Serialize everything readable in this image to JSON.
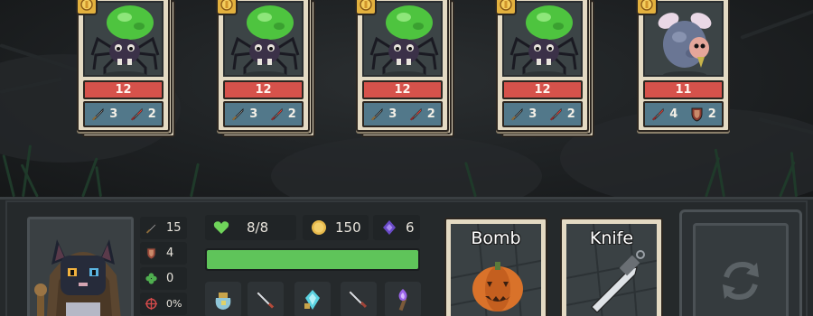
{
  "enemies": [
    {
      "type": "spider",
      "hp": "12",
      "stats": [
        {
          "icon": "sword-icon",
          "value": "3"
        },
        {
          "icon": "red-sword-icon",
          "value": "2"
        }
      ],
      "stacked": true
    },
    {
      "type": "spider",
      "hp": "12",
      "stats": [
        {
          "icon": "sword-icon",
          "value": "3"
        },
        {
          "icon": "red-sword-icon",
          "value": "2"
        }
      ],
      "stacked": true
    },
    {
      "type": "spider",
      "hp": "12",
      "stats": [
        {
          "icon": "sword-icon",
          "value": "3"
        },
        {
          "icon": "red-sword-icon",
          "value": "2"
        }
      ],
      "stacked": true
    },
    {
      "type": "spider",
      "hp": "12",
      "stats": [
        {
          "icon": "sword-icon",
          "value": "3"
        },
        {
          "icon": "red-sword-icon",
          "value": "2"
        }
      ],
      "stacked": true
    },
    {
      "type": "moth",
      "hp": "11",
      "stats": [
        {
          "icon": "red-sword-icon",
          "value": "4"
        },
        {
          "icon": "shield-icon",
          "value": "2"
        }
      ],
      "stacked": false
    }
  ],
  "hero": {
    "stats": {
      "attack": "15",
      "armor": "4",
      "luck": "0",
      "crit": "0%"
    },
    "health": "8/8",
    "gold": "150",
    "mana": "6",
    "energy_level": 1.0
  },
  "items": [
    "pouch-icon",
    "dagger-icon",
    "crystal-icon",
    "knife-icon",
    "torch-icon"
  ],
  "cards": {
    "bomb": "Bomb",
    "knife": "Knife"
  },
  "colors": {
    "hp": "#d6524b",
    "stat_row": "#52788a",
    "energy": "#5fc45a",
    "card": "#e4dac3"
  }
}
